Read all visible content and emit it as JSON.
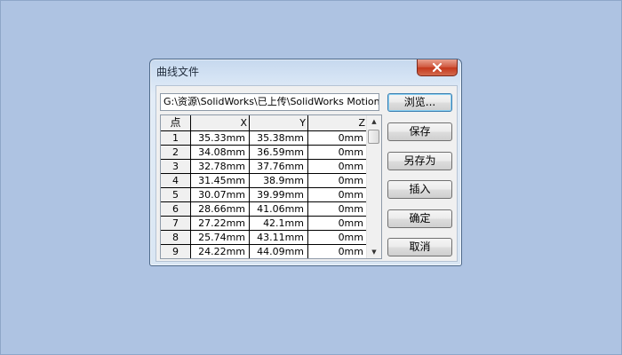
{
  "dialog": {
    "title": "曲线文件",
    "colors": {
      "title_close": "#c4381c",
      "desktop": "#aec3e2"
    },
    "icons": {
      "close": "close-icon"
    },
    "path_value": "G:\\资源\\SolidWorks\\已上传\\SolidWorks Motion",
    "buttons": {
      "browse": "浏览...",
      "save": "保存",
      "save_as": "另存为",
      "insert": "插入",
      "ok": "确定",
      "cancel": "取消"
    },
    "table": {
      "headers": {
        "point": "点",
        "x": "X",
        "y": "Y",
        "z": "Z"
      },
      "rows": [
        {
          "n": "1",
          "x": "35.33mm",
          "y": "35.38mm",
          "z": "0mm"
        },
        {
          "n": "2",
          "x": "34.08mm",
          "y": "36.59mm",
          "z": "0mm"
        },
        {
          "n": "3",
          "x": "32.78mm",
          "y": "37.76mm",
          "z": "0mm"
        },
        {
          "n": "4",
          "x": "31.45mm",
          "y": "38.9mm",
          "z": "0mm"
        },
        {
          "n": "5",
          "x": "30.07mm",
          "y": "39.99mm",
          "z": "0mm"
        },
        {
          "n": "6",
          "x": "28.66mm",
          "y": "41.06mm",
          "z": "0mm"
        },
        {
          "n": "7",
          "x": "27.22mm",
          "y": "42.1mm",
          "z": "0mm"
        },
        {
          "n": "8",
          "x": "25.74mm",
          "y": "43.11mm",
          "z": "0mm"
        },
        {
          "n": "9",
          "x": "24.22mm",
          "y": "44.09mm",
          "z": "0mm"
        }
      ]
    },
    "scroll": {
      "up_glyph": "▲",
      "down_glyph": "▼"
    }
  }
}
